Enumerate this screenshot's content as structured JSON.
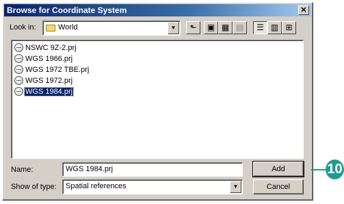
{
  "window": {
    "title": "Browse for Coordinate System",
    "close_glyph": "✕"
  },
  "look_in": {
    "label": "Look in:",
    "value": "World",
    "icon": "folder-icon"
  },
  "toolbar": {
    "buttons": [
      {
        "name": "up-one-level-icon",
        "glyph": "⬑"
      },
      {
        "name": "add-to-catalog-icon",
        "glyph": "▣"
      },
      {
        "name": "connect-folder-icon",
        "glyph": "▦"
      },
      {
        "name": "disconnect-folder-icon",
        "glyph": "▤"
      },
      {
        "name": "list-view-icon",
        "glyph": "☰"
      },
      {
        "name": "details-view-icon",
        "glyph": "▥"
      },
      {
        "name": "thumbnails-view-icon",
        "glyph": "⊞"
      }
    ]
  },
  "files": [
    {
      "name": "NSWC 9Z-2.prj",
      "selected": false
    },
    {
      "name": "WGS 1966.prj",
      "selected": false
    },
    {
      "name": "WGS 1972 TBE.prj",
      "selected": false
    },
    {
      "name": "WGS 1972.prj",
      "selected": false
    },
    {
      "name": "WGS 1984.prj",
      "selected": true
    }
  ],
  "name_field": {
    "label": "Name:",
    "value": "WGS 1984.prj"
  },
  "type_field": {
    "label": "Show of type:",
    "value": "Spatial references"
  },
  "buttons": {
    "add": "Add",
    "cancel": "Cancel"
  },
  "callout": {
    "number": "10",
    "color": "#1f9d8f"
  },
  "colors": {
    "dialog_bg": "#d4d0c8",
    "selection": "#0a246a",
    "title_bar": "#0a246a"
  }
}
